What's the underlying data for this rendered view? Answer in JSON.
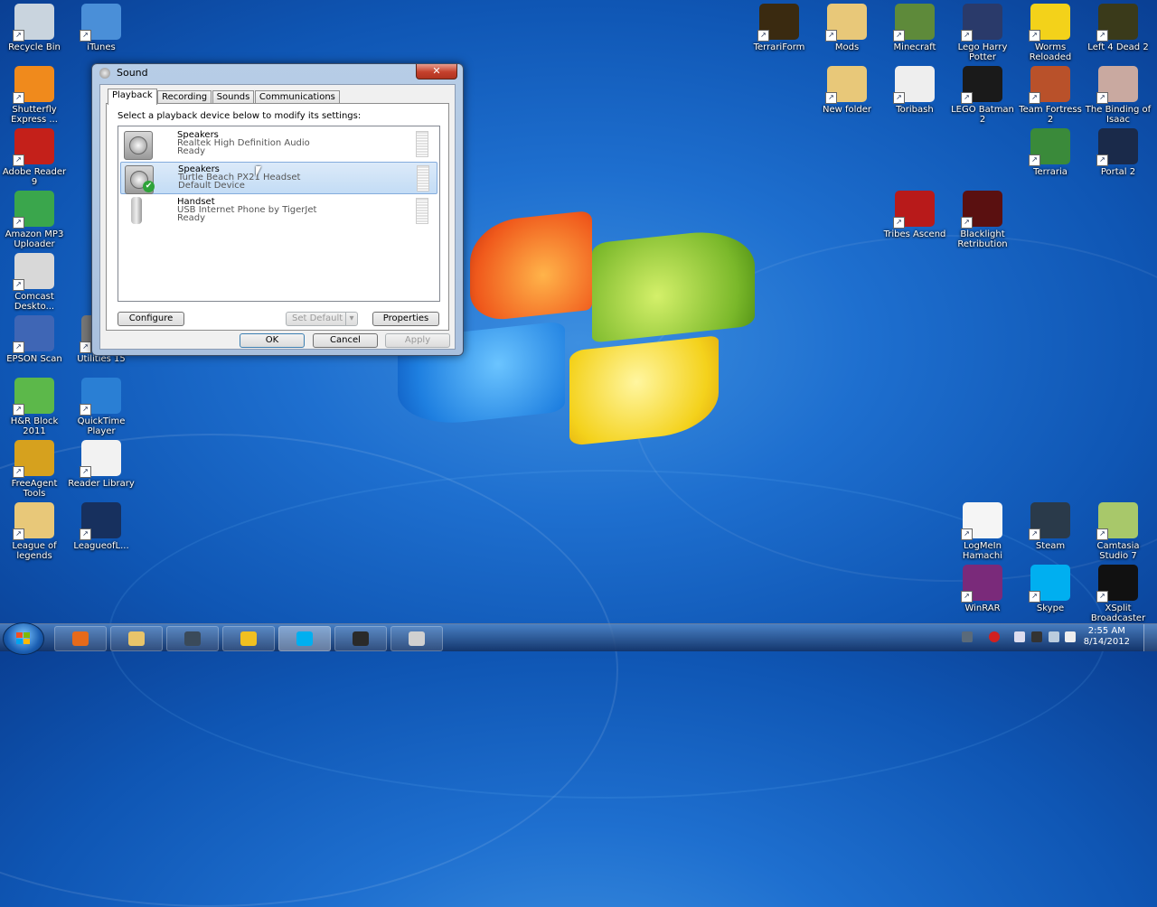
{
  "desktop_left": [
    {
      "label": "Recycle Bin",
      "color": "#c9d4de"
    },
    {
      "label": "iTunes",
      "color": "#4a8fd8"
    },
    {
      "label": "Shutterfly Express ...",
      "color": "#f08a1c"
    },
    {
      "label": "Adobe Reader 9",
      "color": "#c4201a"
    },
    {
      "label": "Amazon MP3 Uploader",
      "color": "#3aa64c"
    },
    {
      "label": "Comcast Deskto...",
      "color": "#d8d8d8"
    },
    {
      "label": "EPSON Scan",
      "color": "#3f66b5"
    },
    {
      "label": "H&R Block 2011",
      "color": "#5cb84a"
    },
    {
      "label": "FreeAgent Tools",
      "color": "#d6a11e"
    },
    {
      "label": "League of legends",
      "color": "#e8c879"
    },
    {
      "label": "QuickTime Player",
      "color": "#2a7fd4"
    },
    {
      "label": "Reader Library",
      "color": "#f2f2f2"
    },
    {
      "label": "LeagueofL...",
      "color": "#17305e"
    },
    {
      "label": "Utilities 15",
      "color": "#777"
    }
  ],
  "desktop_right": [
    {
      "label": "TerrariForm",
      "color": "#3a2a10"
    },
    {
      "label": "Mods",
      "color": "#e8c879"
    },
    {
      "label": "Minecraft",
      "color": "#5e8a3a"
    },
    {
      "label": "Lego Harry Potter",
      "color": "#2a3a6a"
    },
    {
      "label": "Worms Reloaded",
      "color": "#f3d21a"
    },
    {
      "label": "Left 4 Dead 2",
      "color": "#3a3a1a"
    },
    {
      "label": "New folder",
      "color": "#e8c879"
    },
    {
      "label": "Toribash",
      "color": "#eeeeee"
    },
    {
      "label": "LEGO Batman 2",
      "color": "#1a1a1a"
    },
    {
      "label": "Team Fortress 2",
      "color": "#b9512a"
    },
    {
      "label": "The Binding of Isaac",
      "color": "#c9a9a0"
    },
    {
      "label": "Terraria",
      "color": "#3a8a3a"
    },
    {
      "label": "Portal 2",
      "color": "#1a2a4a"
    },
    {
      "label": "Tribes Ascend",
      "color": "#b81a1a"
    },
    {
      "label": "Blacklight Retribution",
      "color": "#5a1010"
    },
    {
      "label": "LogMeIn Hamachi",
      "color": "#f5f5f5"
    },
    {
      "label": "Steam",
      "color": "#2a3a4a"
    },
    {
      "label": "Camtasia Studio 7",
      "color": "#a8c86a"
    },
    {
      "label": "WinRAR",
      "color": "#7a2a7a"
    },
    {
      "label": "Skype",
      "color": "#00aff0"
    },
    {
      "label": "XSplit Broadcaster",
      "color": "#111111"
    }
  ],
  "dialog": {
    "title": "Sound",
    "close_glyph": "✕",
    "tabs": [
      "Playback",
      "Recording",
      "Sounds",
      "Communications"
    ],
    "instruction": "Select a playback device below to modify its settings:",
    "devices": [
      {
        "name": "Speakers",
        "description": "Realtek High Definition Audio",
        "status": "Ready"
      },
      {
        "name": "Speakers",
        "description": "Turtle Beach PX21 Headset",
        "status": "Default Device"
      },
      {
        "name": "Handset",
        "description": "USB Internet Phone by TigerJet",
        "status": "Ready"
      }
    ],
    "configure_label": "Configure",
    "set_default_label": "Set Default",
    "properties_label": "Properties",
    "ok_label": "OK",
    "cancel_label": "Cancel",
    "apply_label": "Apply"
  },
  "taskbar": {
    "time": "2:55 AM",
    "date": "8/14/2012",
    "pinned": [
      {
        "name": "firefox",
        "color": "#e66a1a"
      },
      {
        "name": "explorer",
        "color": "#e8c46a"
      },
      {
        "name": "steam",
        "color": "#3a4a5a"
      },
      {
        "name": "winamp",
        "color": "#f0c020"
      },
      {
        "name": "skype",
        "color": "#00aff0"
      },
      {
        "name": "camera",
        "color": "#2a2a2a"
      },
      {
        "name": "sound",
        "color": "#d0d0d0"
      }
    ]
  }
}
